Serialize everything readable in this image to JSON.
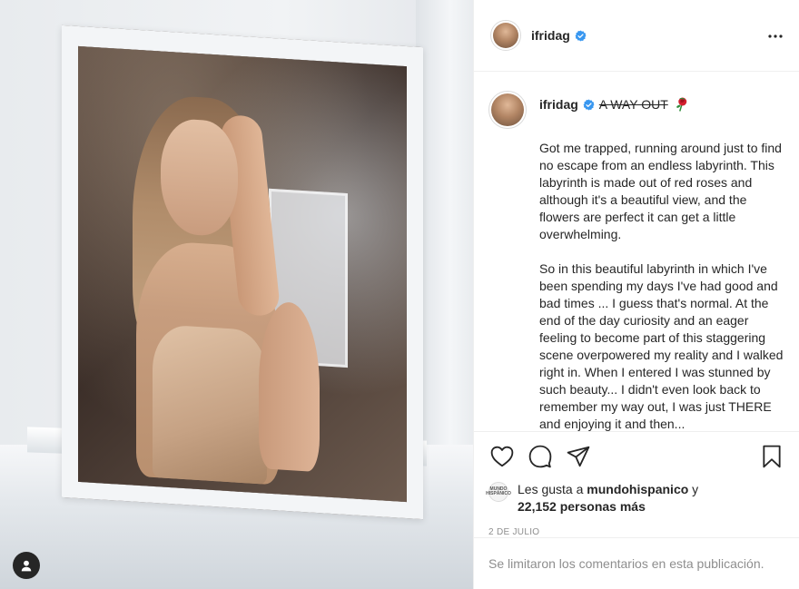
{
  "post": {
    "username": "ifridag",
    "caption_title": "A WAY OUT",
    "caption_paragraphs": [
      "Got me trapped, running around just to find no escape from an endless labyrinth. This labyrinth is made out of red roses and although it's a beautiful view, and the flowers are perfect it can get a little overwhelming.",
      "So in this beautiful labyrinth in which I've been spending my days I've had good and bad times ... I guess that's normal. At the end of the day curiosity and an eager feeling to become part of this staggering scene overpowered my reality and I walked right in. When I entered I was stunned by such beauty... I didn't even look back to remember my way out, I was just THERE and enjoying it and then..."
    ],
    "likes_prefix": "Les gusta a ",
    "likes_user": "mundohispanico",
    "likes_connector": " y",
    "likes_others": "22,152 personas más",
    "liker_avatar_text": "MUNDO HISPÁNICO",
    "date": "2 DE JULIO",
    "comments_disabled": "Se limitaron los comentarios en esta publicación."
  },
  "icons": {
    "verified": "verified-badge-icon",
    "more": "more-options-icon",
    "like": "heart-icon",
    "comment": "comment-icon",
    "share": "share-icon",
    "save": "bookmark-icon",
    "rose": "rose-emoji-icon",
    "user": "user-tag-icon"
  },
  "colors": {
    "verified_blue": "#3897f0",
    "text": "#262626",
    "muted": "#8e8e8e",
    "border": "#efefef"
  }
}
